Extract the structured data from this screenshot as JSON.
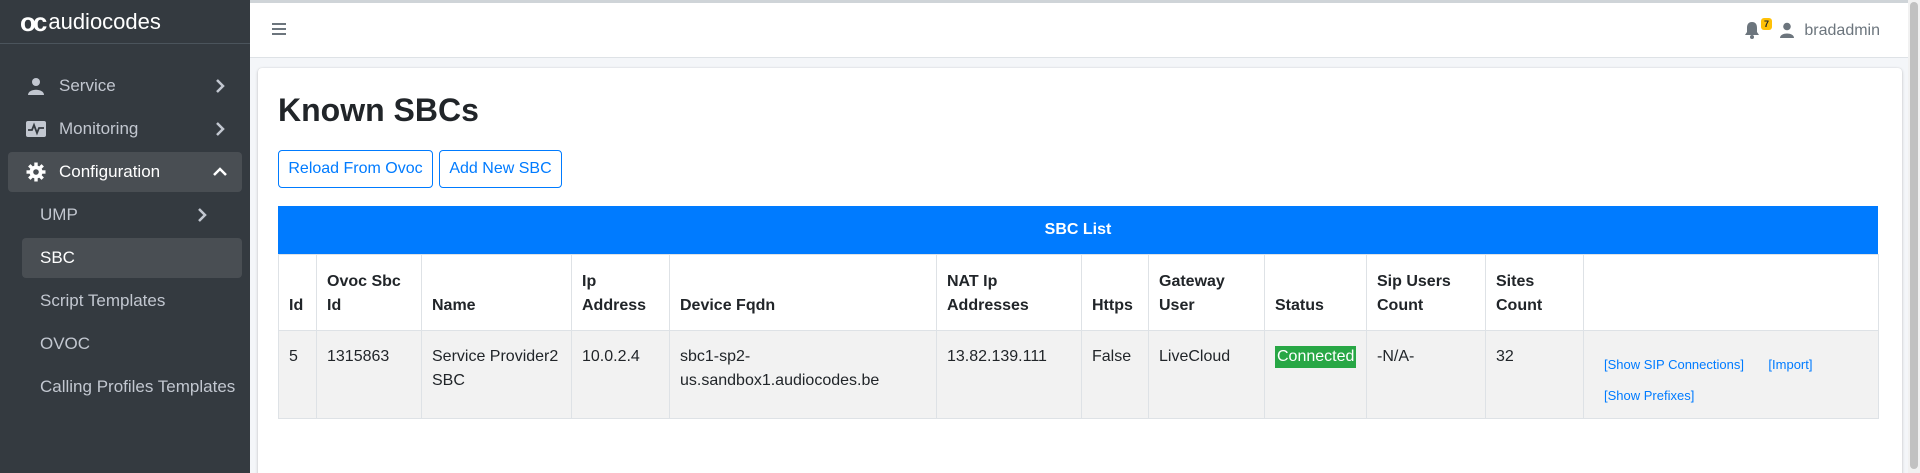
{
  "brand": {
    "mark": "oc",
    "name": "audiocodes"
  },
  "sidebar": {
    "items": [
      {
        "label": "Service",
        "icon": "user-icon"
      },
      {
        "label": "Monitoring",
        "icon": "monitor-chart-icon"
      },
      {
        "label": "Configuration",
        "icon": "gear-icon"
      }
    ],
    "sub_items": [
      {
        "label": "UMP"
      },
      {
        "label": "SBC"
      },
      {
        "label": "Script Templates"
      },
      {
        "label": "OVOC"
      },
      {
        "label": "Calling Profiles Templates"
      }
    ]
  },
  "topbar": {
    "notifications_count": "7",
    "username": "bradadmin"
  },
  "page": {
    "title": "Known SBCs",
    "reload_button": "Reload From Ovoc",
    "add_button": "Add New SBC"
  },
  "table": {
    "caption": "SBC List",
    "headers": [
      "Id",
      "Ovoc Sbc Id",
      "Name",
      "Ip Address",
      "Device Fqdn",
      "NAT Ip Addresses",
      "Https",
      "Gateway User",
      "Status",
      "Sip Users Count",
      "Sites Count",
      ""
    ],
    "rows": [
      {
        "id": "5",
        "ovoc_sbc_id": "1315863",
        "name": "Service Provider2 SBC",
        "ip_address": "10.0.2.4",
        "device_fqdn": "sbc1-sp2-us.sandbox1.audiocodes.be",
        "nat_ip": "13.82.139.111",
        "https": "False",
        "gateway_user": "LiveCloud",
        "status": "Connected",
        "sip_users_count": "-N/A-",
        "sites_count": "32",
        "actions": [
          "[Show SIP Connections]",
          "[Import]",
          "[Show Prefixes]"
        ]
      }
    ]
  },
  "colors": {
    "sidebar_bg": "#343a40",
    "primary": "#007bff",
    "success": "#28a745",
    "badge": "#ffc107"
  }
}
